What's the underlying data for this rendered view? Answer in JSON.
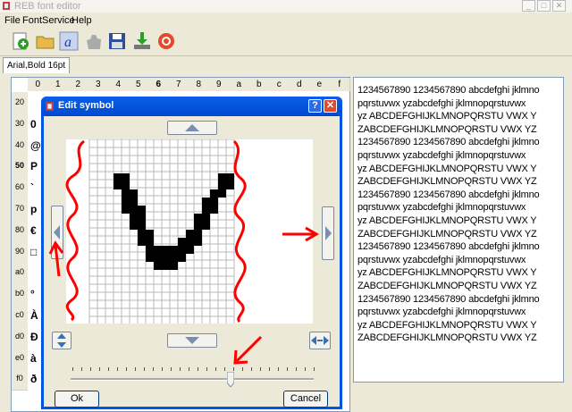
{
  "window": {
    "title": "REB font editor"
  },
  "menu": [
    "File",
    "Font",
    "Service",
    "Help"
  ],
  "toolbar_icons": [
    "new-icon",
    "open-icon",
    "font-icon",
    "hand-icon",
    "save-icon",
    "export-icon",
    "help-icon"
  ],
  "tab": {
    "label": "Arial,Bold 16pt"
  },
  "grid": {
    "columns": [
      "0",
      "1",
      "2",
      "3",
      "4",
      "5",
      "6",
      "7",
      "8",
      "9",
      "a",
      "b",
      "c",
      "d",
      "e",
      "f"
    ],
    "rows": [
      "20",
      "30",
      "40",
      "50",
      "60",
      "70",
      "80",
      "90",
      "a0",
      "b0",
      "c0",
      "d0",
      "e0",
      "f0"
    ],
    "row_chars": [
      "",
      "0",
      "@",
      "P",
      "`",
      "p",
      "€",
      "□",
      "",
      "°",
      "À",
      "Ð",
      "à",
      "ð"
    ]
  },
  "sample_text": [
    "1234567890 1234567890 abcdefghi jklmno",
    "pqrstuvwx yzabcdefghi jklmnopqrstuvwx",
    "yz ABCDEFGHIJKLMNOPQRSTU VWX Y",
    "ZABCDEFGHIJKLMNOPQRSTU VWX YZ",
    "1234567890 1234567890 abcdefghi jklmno",
    "pqrstuvwx yzabcdefghi jklmnopqrstuvwx",
    "yz ABCDEFGHIJKLMNOPQRSTU VWX Y",
    "ZABCDEFGHIJKLMNOPQRSTU VWX YZ",
    "1234567890 1234567890 abcdefghi jklmno",
    "pqrstuvwx yzabcdefghi jklmnopqrstuvwx",
    "yz ABCDEFGHIJKLMNOPQRSTU VWX Y",
    "ZABCDEFGHIJKLMNOPQRSTU VWX YZ",
    "1234567890 1234567890 abcdefghi jklmno",
    "pqrstuvwx yzabcdefghi jklmnopqrstuvwx",
    "yz ABCDEFGHIJKLMNOPQRSTU VWX Y",
    "ZABCDEFGHIJKLMNOPQRSTU VWX YZ",
    "1234567890 1234567890 abcdefghi jklmno",
    "pqrstuvwx yzabcdefghi jklmnopqrstuvwx",
    "yz ABCDEFGHIJKLMNOPQRSTU VWX Y",
    "ZABCDEFGHIJKLMNOPQRSTU VWX YZ"
  ],
  "dialog": {
    "title": "Edit symbol",
    "help_label": "?",
    "close_label": "✕",
    "ok_label": "Ok",
    "cancel_label": "Cancel"
  },
  "glyph": {
    "char": "V",
    "pixels": [
      "                       ",
      "                       ",
      "                       ",
      "   XX           XX     ",
      "   XX           XX     ",
      "    XX         XX      ",
      "    XX        XX       ",
      "    XXX       XX       ",
      "     XX      XX        ",
      "     XX      XX        ",
      "      XX    XX         ",
      "      XX   XXX         ",
      "       XXXXXX          ",
      "       XXXXX           ",
      "        XXX            "
    ]
  },
  "colors": {
    "annotation": "#ff0000",
    "dialog_title": "#0054e3",
    "arrow": "#7a8fb0"
  }
}
